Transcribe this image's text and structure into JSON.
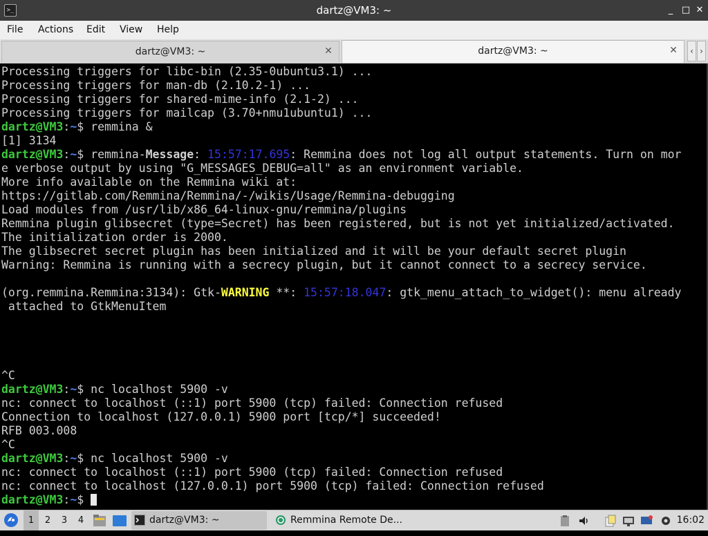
{
  "window": {
    "title": "dartz@VM3: ~",
    "controls": {
      "minimize": "_",
      "maximize": "□",
      "close": "✕"
    }
  },
  "menu": [
    "File",
    "Actions",
    "Edit",
    "View",
    "Help"
  ],
  "tabs": [
    {
      "label": "dartz@VM3: ~",
      "active": false
    },
    {
      "label": "dartz@VM3: ~",
      "active": true
    }
  ],
  "terminal": {
    "prompt": {
      "user": "dartz@VM3",
      "colon": ":",
      "path": "~",
      "symbol": "$ "
    },
    "lines": [
      [
        {
          "t": "Processing triggers for libc-bin (2.35-0ubuntu3.1) ...",
          "c": "n"
        }
      ],
      [
        {
          "t": "Processing triggers for man-db (2.10.2-1) ...",
          "c": "n"
        }
      ],
      [
        {
          "t": "Processing triggers for shared-mime-info (2.1-2) ...",
          "c": "n"
        }
      ],
      [
        {
          "t": "Processing triggers for mailcap (3.70+nmu1ubuntu1) ...",
          "c": "n"
        }
      ],
      [
        {
          "t": "dartz@VM3",
          "c": "user"
        },
        {
          "t": ":",
          "c": "n"
        },
        {
          "t": "~",
          "c": "path"
        },
        {
          "t": "$ remmina &",
          "c": "n"
        }
      ],
      [
        {
          "t": "[1] 3134",
          "c": "n"
        }
      ],
      [
        {
          "t": "dartz@VM3",
          "c": "user"
        },
        {
          "t": ":",
          "c": "n"
        },
        {
          "t": "~",
          "c": "path"
        },
        {
          "t": "$ remmina-",
          "c": "n"
        },
        {
          "t": "Message",
          "c": "msg"
        },
        {
          "t": ": ",
          "c": "n"
        },
        {
          "t": "15:57:17.695",
          "c": "time"
        },
        {
          "t": ": Remmina does not log all output statements. Turn on mor",
          "c": "n"
        }
      ],
      [
        {
          "t": "e verbose output by using \"G_MESSAGES_DEBUG=all\" as an environment variable.",
          "c": "n"
        }
      ],
      [
        {
          "t": "More info available on the Remmina wiki at:",
          "c": "n"
        }
      ],
      [
        {
          "t": "https://gitlab.com/Remmina/Remmina/-/wikis/Usage/Remmina-debugging",
          "c": "n"
        }
      ],
      [
        {
          "t": "Load modules from /usr/lib/x86_64-linux-gnu/remmina/plugins",
          "c": "n"
        }
      ],
      [
        {
          "t": "Remmina plugin glibsecret (type=Secret) has been registered, but is not yet initialized/activated.",
          "c": "n"
        }
      ],
      [
        {
          "t": "The initialization order is 2000.",
          "c": "n"
        }
      ],
      [
        {
          "t": "The glibsecret secret plugin has been initialized and it will be your default secret plugin",
          "c": "n"
        }
      ],
      [
        {
          "t": "Warning: Remmina is running with a secrecy plugin, but it cannot connect to a secrecy service.",
          "c": "n"
        }
      ],
      [
        {
          "t": "",
          "c": "n"
        }
      ],
      [
        {
          "t": "(org.remmina.Remmina:3134): Gtk-",
          "c": "n"
        },
        {
          "t": "WARNING",
          "c": "warn"
        },
        {
          "t": " **: ",
          "c": "n"
        },
        {
          "t": "15:57:18.047",
          "c": "time"
        },
        {
          "t": ": gtk_menu_attach_to_widget(): menu already",
          "c": "n"
        }
      ],
      [
        {
          "t": " attached to GtkMenuItem",
          "c": "n"
        }
      ],
      [
        {
          "t": "",
          "c": "n"
        }
      ],
      [
        {
          "t": "",
          "c": "n"
        }
      ],
      [
        {
          "t": "",
          "c": "n"
        }
      ],
      [
        {
          "t": "",
          "c": "n"
        }
      ],
      [
        {
          "t": "^C",
          "c": "n"
        }
      ],
      [
        {
          "t": "dartz@VM3",
          "c": "user"
        },
        {
          "t": ":",
          "c": "n"
        },
        {
          "t": "~",
          "c": "path"
        },
        {
          "t": "$ nc localhost 5900 -v",
          "c": "n"
        }
      ],
      [
        {
          "t": "nc: connect to localhost (::1) port 5900 (tcp) failed: Connection refused",
          "c": "n"
        }
      ],
      [
        {
          "t": "Connection to localhost (127.0.0.1) 5900 port [tcp/*] succeeded!",
          "c": "n"
        }
      ],
      [
        {
          "t": "RFB 003.008",
          "c": "n"
        }
      ],
      [
        {
          "t": "^C",
          "c": "n"
        }
      ],
      [
        {
          "t": "dartz@VM3",
          "c": "user"
        },
        {
          "t": ":",
          "c": "n"
        },
        {
          "t": "~",
          "c": "path"
        },
        {
          "t": "$ nc localhost 5900 -v",
          "c": "n"
        }
      ],
      [
        {
          "t": "nc: connect to localhost (::1) port 5900 (tcp) failed: Connection refused",
          "c": "n"
        }
      ],
      [
        {
          "t": "nc: connect to localhost (127.0.0.1) port 5900 (tcp) failed: Connection refused",
          "c": "n"
        }
      ],
      [
        {
          "t": "dartz@VM3",
          "c": "user"
        },
        {
          "t": ":",
          "c": "n"
        },
        {
          "t": "~",
          "c": "path"
        },
        {
          "t": "$ ",
          "c": "n"
        },
        {
          "t": "",
          "c": "cursor"
        }
      ]
    ]
  },
  "taskbar": {
    "workspaces": [
      "1",
      "2",
      "3",
      "4"
    ],
    "active_workspace": "1",
    "tasks": [
      {
        "label": "dartz@VM3: ~",
        "icon": "terminal-icon",
        "active": true
      },
      {
        "label": "Remmina Remote De...",
        "icon": "remmina-icon",
        "active": false
      }
    ],
    "clock": "16:02"
  },
  "colors": {
    "prompt_user": "#3ec93e",
    "prompt_path": "#4f7fe6",
    "warning": "#ffff3b",
    "timestamp": "#3434d8",
    "terminal_bg": "#000000",
    "terminal_fg": "#d0d0d0"
  }
}
